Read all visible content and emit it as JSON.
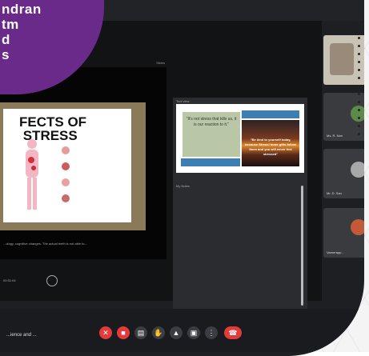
{
  "decoration": {
    "purple_text": "ndran\ntm\nd\ns"
  },
  "left_panel": {
    "top_label": "Slides",
    "slide_title": "FECTS OF\n STRESS",
    "caption": "...ology, cognitive changes. The actual teeth is not able to...",
    "timer": "00:31:04"
  },
  "right_panel": {
    "label": "Tool view",
    "quote_green": "\"It's not stress that kills us, it is our reaction to it.\"",
    "quote_sunset": "\"Be kind to yourself today, because Stress! Inner gifts follow them and you will never feel stressed\"",
    "notes_label": "My Notes"
  },
  "participants": [
    {
      "name": ""
    },
    {
      "name": "Ms. R. Nan"
    },
    {
      "name": "Mr. D. San"
    },
    {
      "name": "Varnerapp..."
    }
  ],
  "controls": {
    "meeting_name": "...ience and ...",
    "buttons": [
      "mic-off",
      "video-off",
      "captions",
      "raise-hand",
      "present",
      "reactions",
      "more",
      "end-call"
    ]
  },
  "colors": {
    "purple": "#6a2a8a",
    "red": "#e23b3b",
    "dark": "#1e1f22"
  }
}
